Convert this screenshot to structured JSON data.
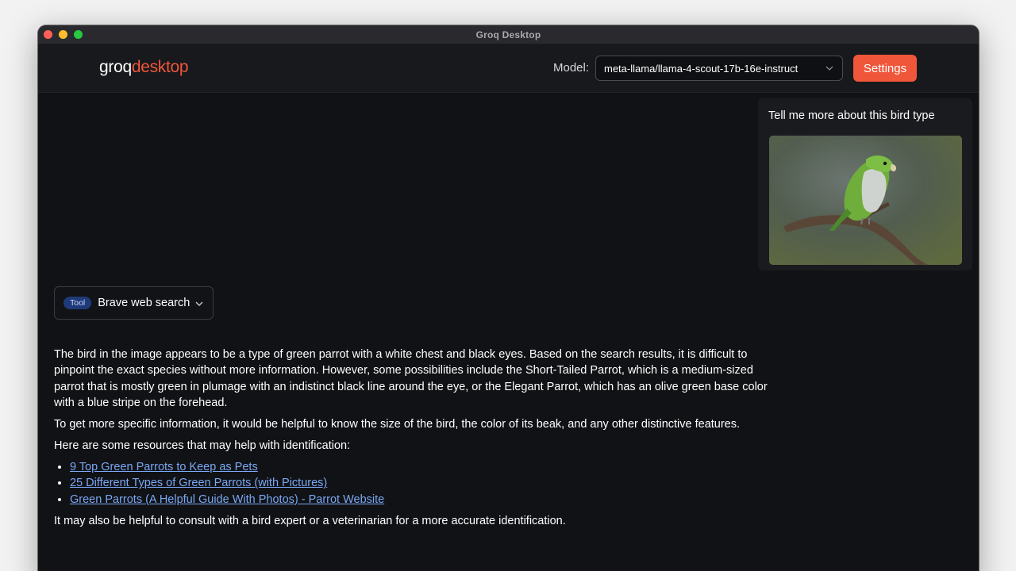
{
  "window": {
    "title": "Groq Desktop"
  },
  "header": {
    "logo_part1": "groq",
    "logo_part2": "desktop",
    "model_label": "Model:",
    "model_value": "meta-llama/llama-4-scout-17b-16e-instruct",
    "settings_label": "Settings"
  },
  "user_message": {
    "text": "Tell me more about this bird type"
  },
  "tool_call": {
    "badge": "Tool",
    "name": "Brave web search"
  },
  "assistant_message": {
    "p1": "The bird in the image appears to be a type of green parrot with a white chest and black eyes. Based on the search results, it is difficult to pinpoint the exact species without more information. However, some possibilities include the Short-Tailed Parrot, which is a medium-sized parrot that is mostly green in plumage with an indistinct black line around the eye, or the Elegant Parrot, which has an olive green base color with a blue stripe on the forehead.",
    "p2": "To get more specific information, it would be helpful to know the size of the bird, the color of its beak, and any other distinctive features.",
    "p3": "Here are some resources that may help with identification:",
    "links": [
      "9 Top Green Parrots to Keep as Pets",
      "25 Different Types of Green Parrots (with Pictures)",
      "Green Parrots (A Helpful Guide With Photos) - Parrot Website"
    ],
    "p4": "It may also be helpful to consult with a bird expert or a veterinarian for a more accurate identification."
  },
  "colors": {
    "accent": "#f0563a",
    "background": "#111215",
    "link": "#7aa8f5",
    "tool_badge": "#1f3a78"
  },
  "icons": {
    "model_dropdown": "chevron-down-icon",
    "tool_expand": "chevron-down-icon"
  }
}
